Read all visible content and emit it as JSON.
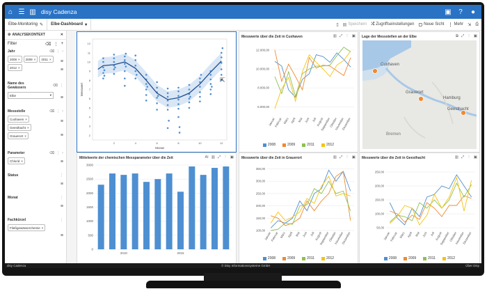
{
  "app": {
    "title": "disy Cadenza",
    "icons": [
      "home-icon",
      "menu-icon",
      "map-book-icon"
    ],
    "right_icons": [
      "bookmark-icon",
      "help-icon",
      "user-icon"
    ]
  },
  "tabs": [
    {
      "label": "Elbe-Monitoring",
      "icon": "edit-icon"
    },
    {
      "label": "Elbe-Dashboard",
      "icon": "chevron-down-icon"
    }
  ],
  "toolbar": {
    "save": "Speichern",
    "change_state": "Zugriffseinstellungen",
    "new_view": "Neue Sicht",
    "more": "Mehr"
  },
  "sidebar": {
    "header": "ANALYSEKONTEXT",
    "filter_label": "Filter",
    "sections": [
      {
        "title": "Jahr",
        "chips": [
          "2008",
          "2009",
          "2011",
          "2012"
        ]
      },
      {
        "title": "Name des Gewässers",
        "select": "Elbe"
      },
      {
        "title": "Messstelle",
        "chips": [
          "Cuxhaven",
          "Geesthacht",
          "Grauerort"
        ]
      },
      {
        "title": "Parameter",
        "chips": [
          "Chlorid"
        ]
      },
      {
        "title": "Status",
        "chips": []
      },
      {
        "title": "Monat",
        "chips": []
      },
      {
        "title": "Fachkürzel",
        "chips": [
          "Fließgewässerchemie"
        ]
      }
    ]
  },
  "status": {
    "left": "disy Cadenza",
    "center": "© Disy Informationssysteme GmbH",
    "right": "Über Disy"
  },
  "colors": {
    "blue": "#4e8fd1",
    "orange": "#f08a30",
    "green": "#8cc152",
    "yellow": "#f5c312",
    "topbar": "#2a72c4"
  },
  "panels": {
    "scatter": {
      "xlabel": "Monat",
      "ylabel": "Messwert"
    },
    "bar": {
      "title": "Mittelwerte der chemischen Messparameter über die Zeit"
    },
    "cux": {
      "title": "Messwerte über die Zeit in Cuxhaven"
    },
    "map": {
      "title": "Lage der Messstellen an der Elbe",
      "places": [
        "Cuxhaven",
        "Grauerort",
        "Hamburg",
        "Geesthacht",
        "Bremen"
      ]
    },
    "grau": {
      "title": "Messwerte über die Zeit in Grauerort"
    },
    "gees": {
      "title": "Messwerte über die Zeit in Geesthacht"
    }
  },
  "chart_data": [
    {
      "type": "scatter",
      "xlabel": "Monat",
      "ylabel": "Messwert",
      "x_ticks": [
        2,
        4,
        6,
        8,
        10,
        12
      ],
      "y_ticks": [
        2,
        3,
        4,
        5,
        6,
        7,
        8,
        9,
        10,
        11,
        12
      ],
      "xlim": [
        0,
        12.5
      ],
      "ylim": [
        1.5,
        12.5
      ],
      "trend": [
        [
          0.5,
          9.2
        ],
        [
          1,
          9.6
        ],
        [
          2,
          9.7
        ],
        [
          3,
          10.0
        ],
        [
          4,
          9.3
        ],
        [
          5,
          8.0
        ],
        [
          6,
          6.6
        ],
        [
          7,
          5.9
        ],
        [
          8,
          6.1
        ],
        [
          9,
          6.6
        ],
        [
          10,
          7.6
        ],
        [
          11,
          8.9
        ],
        [
          12,
          10.1
        ]
      ],
      "points": [
        [
          1,
          8.2
        ],
        [
          1,
          8.8
        ],
        [
          1,
          9.4
        ],
        [
          1,
          10.0
        ],
        [
          1,
          10.4
        ],
        [
          1.1,
          9.1
        ],
        [
          1.1,
          8.5
        ],
        [
          2,
          8.7
        ],
        [
          2,
          9.2
        ],
        [
          2,
          9.6
        ],
        [
          2,
          10.0
        ],
        [
          2,
          10.4
        ],
        [
          2,
          10.8
        ],
        [
          2.1,
          9.4
        ],
        [
          3,
          7.4
        ],
        [
          3,
          8.2
        ],
        [
          3,
          9.0
        ],
        [
          3,
          9.8
        ],
        [
          3,
          10.2
        ],
        [
          3,
          10.6
        ],
        [
          3.1,
          9.5
        ],
        [
          3.1,
          10.9
        ],
        [
          4,
          8.2
        ],
        [
          4,
          9.0
        ],
        [
          4,
          9.6
        ],
        [
          4,
          10.2
        ],
        [
          4,
          10.7
        ],
        [
          4.1,
          8.6
        ],
        [
          5,
          5.8
        ],
        [
          5,
          6.4
        ],
        [
          5,
          7.0
        ],
        [
          5,
          7.6
        ],
        [
          5,
          8.1
        ],
        [
          5,
          8.6
        ],
        [
          5.1,
          7.3
        ],
        [
          6,
          4.8
        ],
        [
          6,
          5.5
        ],
        [
          6,
          6.1
        ],
        [
          6,
          6.7
        ],
        [
          6,
          7.2
        ],
        [
          6,
          7.8
        ],
        [
          6.1,
          6.3
        ],
        [
          7,
          2.8
        ],
        [
          7,
          4.8
        ],
        [
          7,
          5.3
        ],
        [
          7,
          5.8
        ],
        [
          7,
          6.2
        ],
        [
          7,
          6.6
        ],
        [
          7,
          7.1
        ],
        [
          7.1,
          3.6
        ],
        [
          8,
          4.0
        ],
        [
          8,
          4.9
        ],
        [
          8,
          5.4
        ],
        [
          8,
          5.9
        ],
        [
          8,
          6.3
        ],
        [
          8,
          6.8
        ],
        [
          8,
          7.2
        ],
        [
          8.1,
          2.9
        ],
        [
          8.1,
          2.3
        ],
        [
          9,
          5.0
        ],
        [
          9,
          5.6
        ],
        [
          9,
          6.0
        ],
        [
          9,
          6.5
        ],
        [
          9,
          7.0
        ],
        [
          9,
          7.5
        ],
        [
          9.1,
          6.2
        ],
        [
          10,
          5.7
        ],
        [
          10,
          6.2
        ],
        [
          10,
          6.7
        ],
        [
          10,
          7.3
        ],
        [
          10,
          7.8
        ],
        [
          10,
          8.2
        ],
        [
          10.1,
          8.6
        ],
        [
          11,
          6.5
        ],
        [
          11,
          7.0
        ],
        [
          11,
          7.6
        ],
        [
          11,
          8.1
        ],
        [
          11,
          8.6
        ],
        [
          11,
          9.0
        ],
        [
          11.1,
          7.3
        ],
        [
          12,
          8.0
        ],
        [
          12,
          8.6
        ],
        [
          12,
          9.2
        ],
        [
          12,
          9.9
        ],
        [
          12,
          10.5
        ],
        [
          12,
          11.0
        ],
        [
          12.1,
          11.5
        ]
      ]
    },
    {
      "type": "bar",
      "title": "Mittelwerte der chemischen Messparameter über die Zeit",
      "ylim": [
        0,
        3000
      ],
      "y_ticks": [
        0,
        500,
        1000,
        1500,
        2000,
        2500,
        3000
      ],
      "x_tick_labels": [
        "2010",
        "2015"
      ],
      "values": [
        2300,
        2700,
        2650,
        2700,
        2400,
        2500,
        2700,
        2050,
        2950,
        2650,
        2900,
        2950
      ]
    },
    {
      "type": "line",
      "title": "Messwerte über die Zeit in Cuxhaven",
      "categories": [
        "Januar",
        "Februar",
        "März",
        "April",
        "Mai",
        "Juni",
        "Juli",
        "August",
        "September",
        "Oktober",
        "November",
        "Dezember"
      ],
      "ylim": [
        5000,
        12500
      ],
      "y_ticks": [
        6000,
        8000,
        10000,
        12000
      ],
      "y_tick_labels": [
        "6.000,00",
        "8.000,00",
        "10.000,00",
        "12.000,00"
      ],
      "series": [
        {
          "name": "2008",
          "values": [
            10800,
            10300,
            7800,
            7000,
            8900,
            9500,
            11500,
            11300,
            10700,
            11700,
            11000,
            10200
          ]
        },
        {
          "name": "2009",
          "values": [
            12000,
            8700,
            10500,
            9200,
            7800,
            11200,
            10100,
            10400,
            10300,
            9800,
            9300,
            11200
          ]
        },
        {
          "name": "2011",
          "values": [
            9200,
            7400,
            9700,
            7100,
            9500,
            10000,
            10300,
            10300,
            10400,
            11400,
            12300,
            11800
          ]
        },
        {
          "name": "2012",
          "values": [
            5800,
            7900,
            9100,
            6600,
            9700,
            11500,
            10700,
            10000,
            9200,
            10400,
            10900,
            11900
          ]
        }
      ]
    },
    {
      "type": "line",
      "title": "Messwerte über die Zeit in Grauerort",
      "categories": [
        "Januar",
        "Februar",
        "März",
        "April",
        "Mai",
        "Juni",
        "Juli",
        "August",
        "September",
        "Oktober",
        "November",
        "Dezember"
      ],
      "ylim": [
        100,
        360
      ],
      "y_ticks": [
        100,
        150,
        200,
        250,
        300,
        350
      ],
      "y_tick_labels": [
        "100,00",
        "150,00",
        "200,00",
        "250,00",
        "300,00",
        "350,00"
      ],
      "series": [
        {
          "name": "2008",
          "values": [
            110,
            140,
            130,
            150,
            220,
            180,
            250,
            270,
            345,
            300,
            340,
            260
          ]
        },
        {
          "name": "2009",
          "values": [
            160,
            150,
            120,
            130,
            150,
            220,
            180,
            220,
            250,
            320,
            340,
            140
          ]
        },
        {
          "name": "2011",
          "values": [
            100,
            105,
            130,
            125,
            200,
            205,
            270,
            250,
            300,
            250,
            260,
            180
          ]
        },
        {
          "name": "2012",
          "values": [
            130,
            175,
            140,
            155,
            175,
            230,
            210,
            280,
            320,
            240,
            250,
            240
          ]
        }
      ]
    },
    {
      "type": "line",
      "title": "Messwerte über die Zeit in Geesthacht",
      "categories": [
        "Januar",
        "Februar",
        "März",
        "April",
        "Mai",
        "Juni",
        "Juli",
        "August",
        "September",
        "Oktober",
        "November",
        "Dezember"
      ],
      "ylim": [
        40,
        270
      ],
      "y_ticks": [
        50,
        100,
        150,
        200,
        250
      ],
      "y_tick_labels": [
        "50,00",
        "100,00",
        "150,00",
        "200,00",
        "250,00"
      ],
      "series": [
        {
          "name": "2008",
          "values": [
            140,
            85,
            60,
            120,
            90,
            160,
            170,
            200,
            190,
            240,
            200,
            160
          ]
        },
        {
          "name": "2009",
          "values": [
            110,
            100,
            70,
            95,
            80,
            140,
            120,
            90,
            130,
            130,
            165,
            155
          ]
        },
        {
          "name": "2011",
          "values": [
            70,
            95,
            90,
            75,
            140,
            120,
            150,
            120,
            150,
            210,
            160,
            205
          ]
        },
        {
          "name": "2012",
          "values": [
            65,
            90,
            130,
            120,
            60,
            95,
            170,
            120,
            160,
            230,
            110,
            220
          ]
        }
      ]
    }
  ]
}
